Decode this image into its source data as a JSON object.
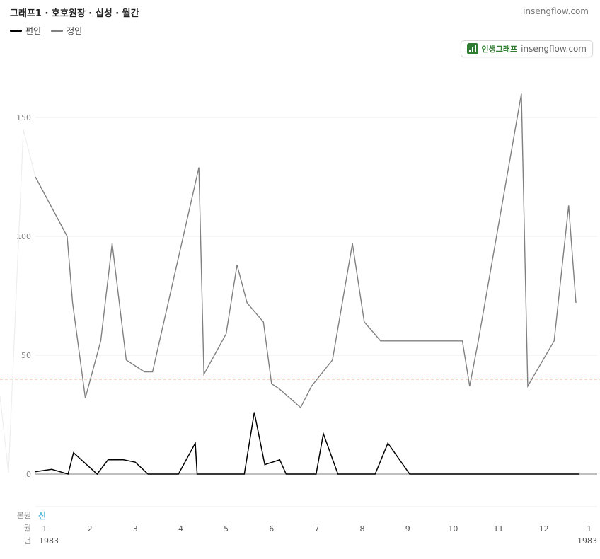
{
  "header": {
    "title": "그래프1 · 호호원장 · 십성 · 월간",
    "site": "insengflow.com"
  },
  "badge": {
    "name": "인생그래프",
    "site": "insengflow.com"
  },
  "chart_data": {
    "type": "line",
    "ylim": [
      0,
      160
    ],
    "yticks": [
      0,
      50,
      100,
      150
    ],
    "grid": true,
    "legend_position": "top-left",
    "x": [
      0.0,
      0.19,
      0.5,
      0.61,
      0.88,
      1.22,
      1.44,
      1.75,
      2.04,
      2.23,
      2.53,
      2.84,
      3.17,
      3.5,
      3.79,
      4.1,
      4.38,
      4.48,
      4.92,
      5.24,
      5.5,
      5.86,
      6.2,
      6.46,
      6.64,
      6.98,
      7.24,
      7.5,
      7.7,
      8.24,
      8.5,
      8.78,
      9.24,
      9.58,
      10.26,
      10.56,
      10.68,
      11.44,
      11.57,
      11.8,
      12.3,
      12.58
    ],
    "series": [
      {
        "name": "편인",
        "color": "#000000",
        "values": [
          1,
          2,
          0,
          9,
          0,
          6,
          6,
          5,
          0,
          0,
          0,
          13,
          0,
          0,
          0,
          0,
          26,
          4,
          6,
          0,
          0,
          17,
          0,
          0,
          0,
          0,
          13,
          0,
          0,
          0,
          0,
          0,
          0,
          0,
          0,
          0,
          0,
          0,
          0,
          0,
          0,
          0
        ]
      },
      {
        "name": "정인",
        "color": "#808080",
        "values": [
          125,
          100,
          72,
          32,
          56,
          97,
          48,
          43,
          43,
          129,
          42,
          59,
          88,
          72,
          64,
          38,
          36,
          28,
          37,
          48,
          97,
          64,
          56,
          56,
          56,
          37,
          56,
          160,
          37,
          56,
          113,
          72
        ]
      }
    ],
    "reference_line": {
      "value": 40,
      "color": "#d0665e",
      "style": "dashed"
    },
    "x_rows": {
      "본원": "신",
      "월": [
        "1",
        "2",
        "3",
        "4",
        "5",
        "6",
        "7",
        "8",
        "9",
        "10",
        "11",
        "12",
        "1"
      ],
      "년": [
        "1983",
        "1983"
      ]
    }
  }
}
